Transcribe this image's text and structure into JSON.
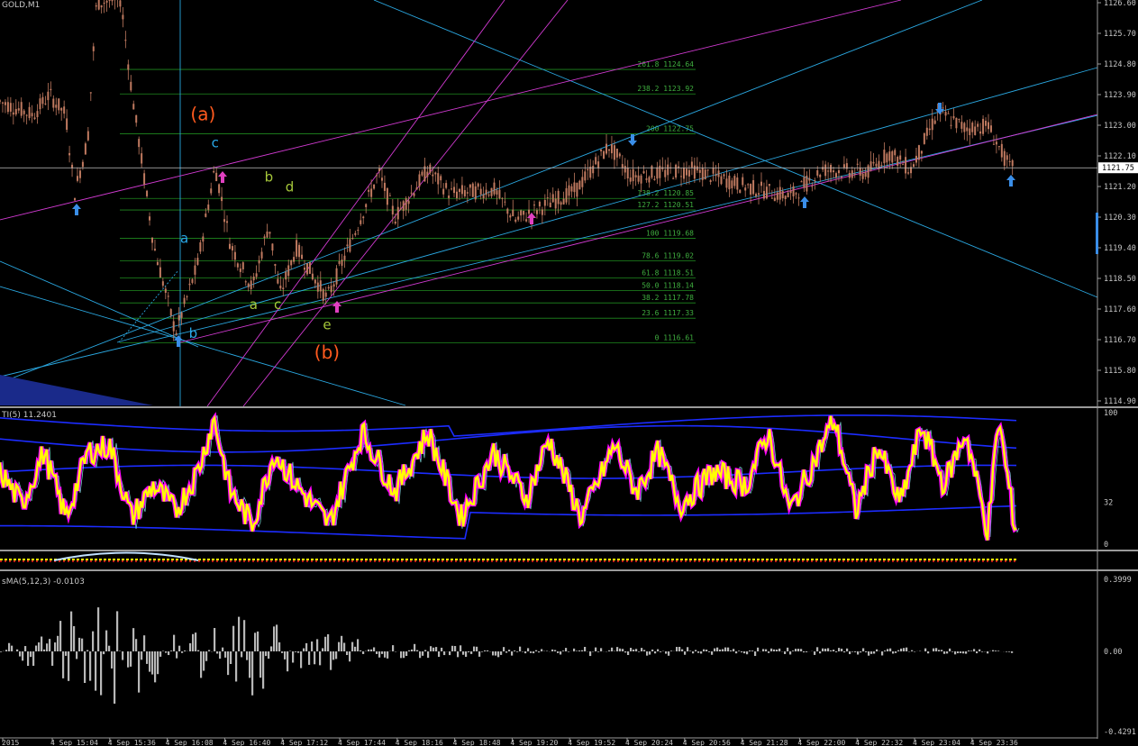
{
  "window": {
    "symbol_label": "GOLD,M1"
  },
  "colors": {
    "background": "#000000",
    "candle": "#c07a60",
    "fib": "#1f8a1f",
    "fib_text": "#3fae3f",
    "cyan_line": "#2aa7e0",
    "magenta_line": "#d23ad2",
    "arrow": "#3a8ee8",
    "arrow_magenta": "#e040c0",
    "wave_orange": "#ff5a1e",
    "wave_cyan": "#29a8e8",
    "wave_green": "#a6c83a",
    "stoch_main": "#ffff00",
    "stoch_dots": "#ff00ff",
    "stoch_thin": "#7fe0e0",
    "bands": "#1c2cff",
    "histogram": "#b8b8b8",
    "axis_text": "#c8c8c8",
    "price_line": "#c0c0c0",
    "band_fill": "#1a2a8a"
  },
  "main": {
    "current_price": 1121.75,
    "price_scale": [
      "1126.60",
      "1125.70",
      "1124.80",
      "1123.90",
      "1123.00",
      "1122.10",
      "1121.20",
      "1120.30",
      "1119.40",
      "1118.50",
      "1117.60",
      "1116.70",
      "1115.80",
      "1114.90"
    ],
    "fib_levels": [
      {
        "ratio": "261.8",
        "price": "1124.64"
      },
      {
        "ratio": "238.2",
        "price": "1123.92"
      },
      {
        "ratio": "200",
        "price": "1122.75"
      },
      {
        "ratio": "138.2",
        "price": "1120.85"
      },
      {
        "ratio": "127.2",
        "price": "1120.51"
      },
      {
        "ratio": "100",
        "price": "1119.68"
      },
      {
        "ratio": "78.6",
        "price": "1119.02"
      },
      {
        "ratio": "61.8",
        "price": "1118.51"
      },
      {
        "ratio": "50.0",
        "price": "1118.14"
      },
      {
        "ratio": "38.2",
        "price": "1117.78"
      },
      {
        "ratio": "23.6",
        "price": "1117.33"
      },
      {
        "ratio": "0",
        "price": "1116.61"
      }
    ],
    "wave_labels": [
      {
        "text": "(a)",
        "color": "wave_orange",
        "t": 0.185,
        "p": 1123.15
      },
      {
        "text": "c",
        "color": "wave_cyan",
        "t": 0.196,
        "p": 1122.35
      },
      {
        "text": "a",
        "color": "wave_cyan",
        "t": 0.168,
        "p": 1119.55
      },
      {
        "text": "b",
        "color": "wave_cyan",
        "t": 0.176,
        "p": 1116.75
      },
      {
        "text": "b",
        "color": "wave_green",
        "t": 0.245,
        "p": 1121.35
      },
      {
        "text": "d",
        "color": "wave_green",
        "t": 0.264,
        "p": 1121.05
      },
      {
        "text": "a",
        "color": "wave_green",
        "t": 0.231,
        "p": 1117.6
      },
      {
        "text": "c",
        "color": "wave_green",
        "t": 0.253,
        "p": 1117.6
      },
      {
        "text": "e",
        "color": "wave_green",
        "t": 0.298,
        "p": 1117.0
      },
      {
        "text": "(b)",
        "color": "wave_orange",
        "t": 0.298,
        "p": 1116.15
      }
    ]
  },
  "stoch": {
    "label": "TI(5) 11.2401",
    "scale": [
      "100",
      "32",
      "0"
    ]
  },
  "histogram": {
    "label": "sMA(5,12,3) -0.0103",
    "scale": [
      "0.3999",
      "0.00",
      "-0.4291"
    ]
  },
  "time_axis": [
    "2015",
    "4 Sep 15:04",
    "4 Sep 15:36",
    "4 Sep 16:08",
    "4 Sep 16:40",
    "4 Sep 17:12",
    "4 Sep 17:44",
    "4 Sep 18:16",
    "4 Sep 18:48",
    "4 Sep 19:20",
    "4 Sep 19:52",
    "4 Sep 20:24",
    "4 Sep 20:56",
    "4 Sep 21:28",
    "4 Sep 22:00",
    "4 Sep 22:32",
    "4 Sep 23:04",
    "4 Sep 23:36"
  ],
  "chart_data": {
    "type": "candlestick",
    "symbol": "GOLD",
    "timeframe": "M1",
    "price_anchors": [
      [
        0.0,
        1123.7
      ],
      [
        0.03,
        1123.3
      ],
      [
        0.045,
        1123.9
      ],
      [
        0.06,
        1123.3
      ],
      [
        0.068,
        1121.0
      ],
      [
        0.08,
        1122.6
      ],
      [
        0.088,
        1126.6
      ],
      [
        0.11,
        1126.7
      ],
      [
        0.12,
        1124.0
      ],
      [
        0.14,
        1119.5
      ],
      [
        0.16,
        1116.9
      ],
      [
        0.18,
        1118.9
      ],
      [
        0.196,
        1121.8
      ],
      [
        0.21,
        1119.5
      ],
      [
        0.23,
        1118.2
      ],
      [
        0.245,
        1120.1
      ],
      [
        0.255,
        1118.0
      ],
      [
        0.27,
        1119.4
      ],
      [
        0.298,
        1117.9
      ],
      [
        0.32,
        1119.6
      ],
      [
        0.345,
        1121.6
      ],
      [
        0.36,
        1120.3
      ],
      [
        0.39,
        1121.7
      ],
      [
        0.41,
        1121.0
      ],
      [
        0.45,
        1121.1
      ],
      [
        0.47,
        1120.2
      ],
      [
        0.5,
        1120.7
      ],
      [
        0.525,
        1121.1
      ],
      [
        0.555,
        1122.4
      ],
      [
        0.575,
        1121.5
      ],
      [
        0.63,
        1121.7
      ],
      [
        0.68,
        1121.2
      ],
      [
        0.72,
        1120.9
      ],
      [
        0.75,
        1121.7
      ],
      [
        0.79,
        1121.6
      ],
      [
        0.81,
        1122.2
      ],
      [
        0.83,
        1121.7
      ],
      [
        0.855,
        1123.4
      ],
      [
        0.88,
        1122.9
      ],
      [
        0.9,
        1123.0
      ],
      [
        0.92,
        1121.75
      ]
    ],
    "stoch_anchors": [
      [
        0.0,
        55
      ],
      [
        0.02,
        30
      ],
      [
        0.04,
        70
      ],
      [
        0.06,
        20
      ],
      [
        0.08,
        70
      ],
      [
        0.1,
        75
      ],
      [
        0.12,
        20
      ],
      [
        0.14,
        45
      ],
      [
        0.16,
        25
      ],
      [
        0.18,
        55
      ],
      [
        0.195,
        95
      ],
      [
        0.21,
        40
      ],
      [
        0.23,
        15
      ],
      [
        0.25,
        70
      ],
      [
        0.27,
        45
      ],
      [
        0.3,
        15
      ],
      [
        0.33,
        85
      ],
      [
        0.36,
        40
      ],
      [
        0.39,
        85
      ],
      [
        0.42,
        20
      ],
      [
        0.45,
        70
      ],
      [
        0.48,
        35
      ],
      [
        0.5,
        80
      ],
      [
        0.53,
        20
      ],
      [
        0.56,
        75
      ],
      [
        0.58,
        40
      ],
      [
        0.6,
        70
      ],
      [
        0.62,
        30
      ],
      [
        0.65,
        55
      ],
      [
        0.68,
        45
      ],
      [
        0.7,
        85
      ],
      [
        0.72,
        25
      ],
      [
        0.74,
        60
      ],
      [
        0.76,
        95
      ],
      [
        0.78,
        25
      ],
      [
        0.8,
        75
      ],
      [
        0.82,
        30
      ],
      [
        0.84,
        90
      ],
      [
        0.86,
        45
      ],
      [
        0.88,
        85
      ],
      [
        0.9,
        10
      ],
      [
        0.91,
        95
      ],
      [
        0.925,
        12
      ]
    ],
    "hist_anchors": [
      [
        0.0,
        0.03
      ],
      [
        0.05,
        0.12
      ],
      [
        0.08,
        0.25
      ],
      [
        0.09,
        0.35
      ],
      [
        0.1,
        -0.4
      ],
      [
        0.12,
        0.2
      ],
      [
        0.14,
        0.15
      ],
      [
        0.16,
        -0.12
      ],
      [
        0.18,
        0.15
      ],
      [
        0.2,
        0.1
      ],
      [
        0.23,
        0.2
      ],
      [
        0.25,
        0.12
      ],
      [
        0.28,
        0.06
      ],
      [
        0.3,
        0.08
      ],
      [
        0.35,
        0.04
      ],
      [
        0.4,
        0.03
      ],
      [
        0.5,
        0.02
      ],
      [
        0.6,
        0.02
      ],
      [
        0.7,
        0.02
      ],
      [
        0.8,
        0.02
      ],
      [
        0.9,
        0.01
      ],
      [
        0.925,
        -0.01
      ]
    ]
  }
}
